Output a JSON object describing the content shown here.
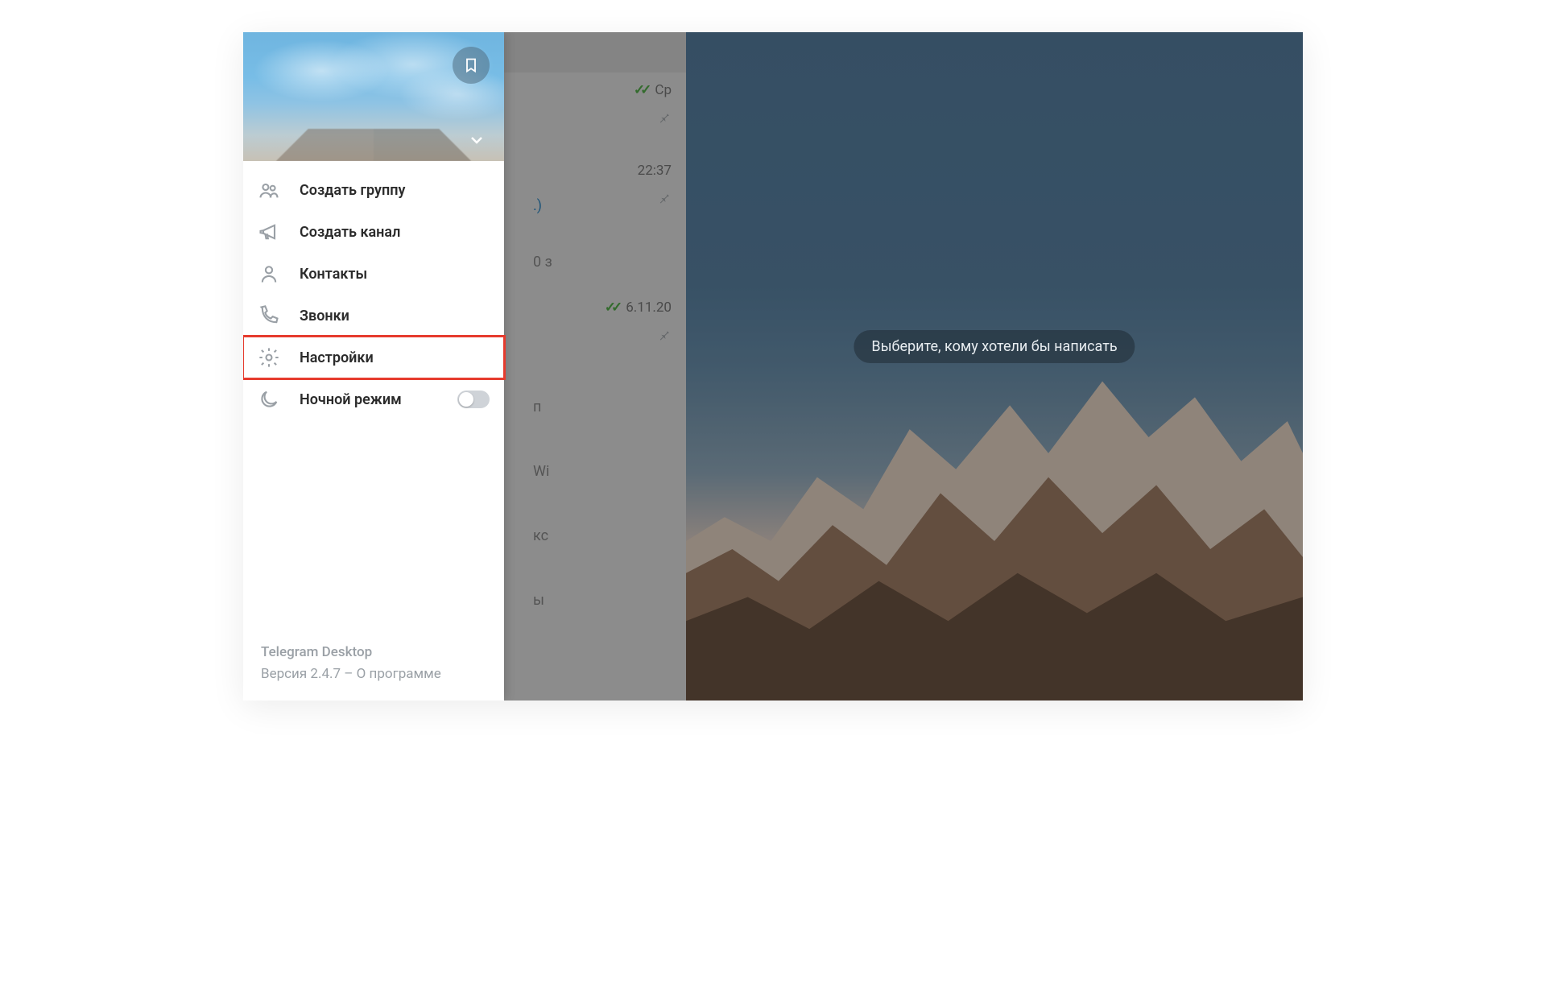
{
  "drawer": {
    "menu": {
      "new_group": "Создать группу",
      "new_channel": "Создать канал",
      "contacts": "Контакты",
      "calls": "Звонки",
      "settings": "Настройки",
      "night_mode": "Ночной режим"
    },
    "night_mode_on": false,
    "footer": {
      "app_name": "Telegram Desktop",
      "version_line": "Версия 2.4.7 – О программе"
    }
  },
  "chat_list": {
    "items": [
      {
        "time": "Ср",
        "read": true,
        "pinned": true
      },
      {
        "time": "22:37",
        "read": false,
        "pinned": true,
        "snippet_suffix": ".)"
      },
      {
        "time": "",
        "read": false,
        "pinned": false,
        "snippet_suffix": "0 з"
      },
      {
        "time": "6.11.20",
        "read": true,
        "pinned": true
      },
      {
        "time": "",
        "read": false,
        "pinned": false,
        "snippet_suffix": "п"
      },
      {
        "time": "",
        "read": false,
        "pinned": false,
        "snippet_suffix": "Wi"
      },
      {
        "time": "",
        "read": false,
        "pinned": false,
        "snippet_suffix": "кс"
      },
      {
        "time": "",
        "read": false,
        "pinned": false,
        "snippet_suffix": "ы"
      }
    ]
  },
  "main": {
    "placeholder": "Выберите, кому хотели бы написать"
  },
  "icons": {
    "bookmark": "bookmark-icon",
    "chevron_down": "chevron-down-icon",
    "group": "group-icon",
    "megaphone": "megaphone-icon",
    "person": "person-icon",
    "phone": "phone-icon",
    "gear": "gear-icon",
    "moon": "moon-icon",
    "pin": "pin-icon",
    "checks": "double-check-icon"
  }
}
